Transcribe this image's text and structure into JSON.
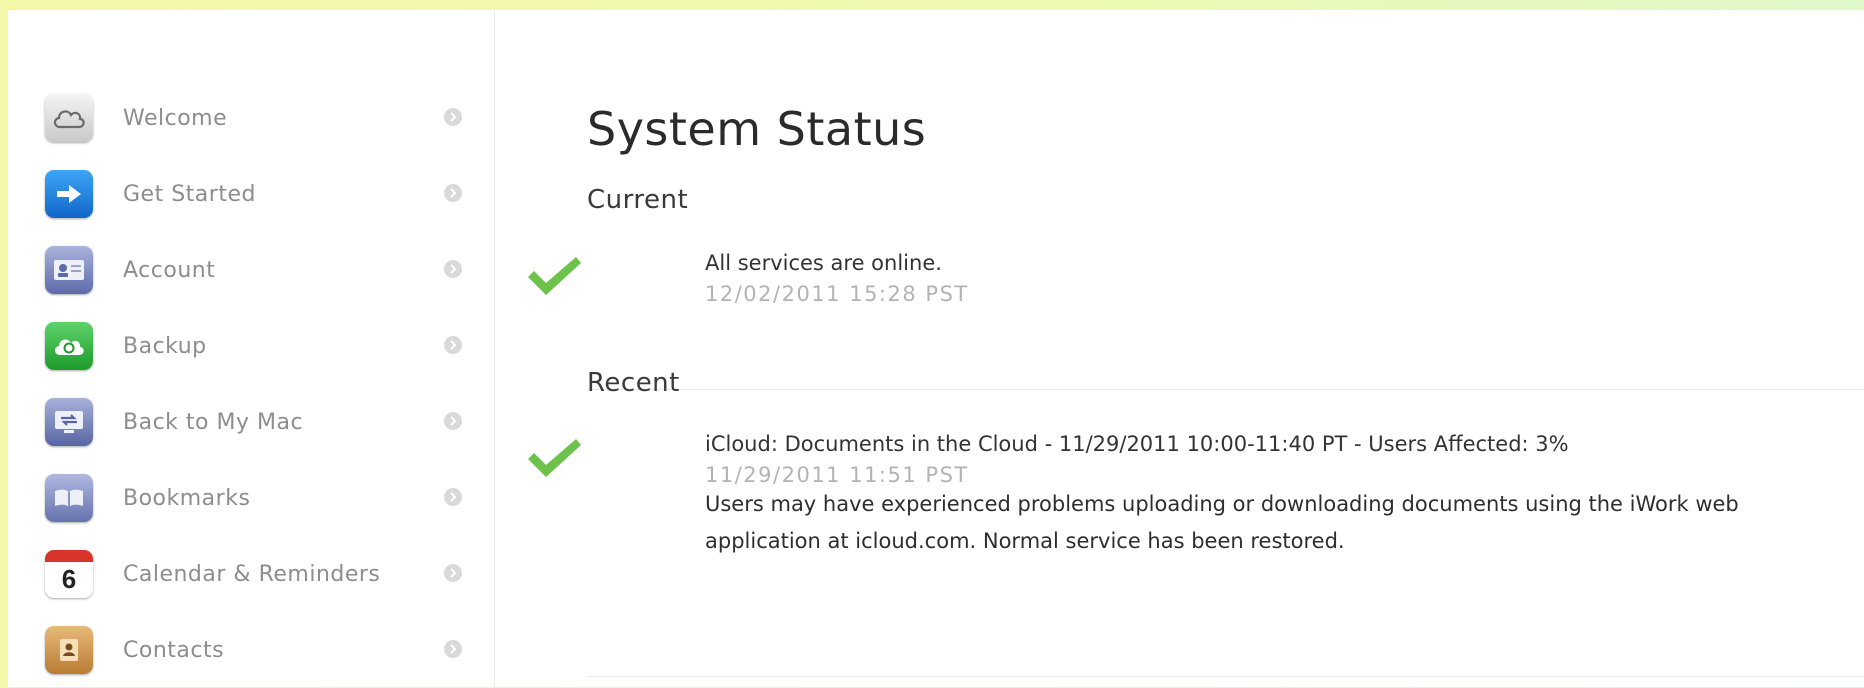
{
  "sidebar": {
    "items": [
      {
        "label": "Welcome",
        "icon": "icloud-icon"
      },
      {
        "label": "Get Started",
        "icon": "arrow-icon"
      },
      {
        "label": "Account",
        "icon": "account-card-icon"
      },
      {
        "label": "Backup",
        "icon": "backup-icon"
      },
      {
        "label": "Back to My Mac",
        "icon": "back-to-my-mac-icon"
      },
      {
        "label": "Bookmarks",
        "icon": "bookmarks-icon"
      },
      {
        "label": "Calendar & Reminders",
        "icon": "calendar-icon",
        "calendar_day": "6"
      },
      {
        "label": "Contacts",
        "icon": "contacts-icon"
      }
    ]
  },
  "main": {
    "title": "System Status",
    "current": {
      "heading": "Current",
      "status": {
        "title": "All services are online.",
        "time": "12/02/2011 15:28 PST",
        "icon": "checkmark-icon"
      }
    },
    "recent": {
      "heading": "Recent",
      "status": {
        "title": "iCloud: Documents in the Cloud - 11/29/2011 10:00-11:40 PT - Users Affected: 3%",
        "time": "11/29/2011 11:51 PST",
        "description": "Users may have experienced problems uploading or downloading documents using the iWork web application at icloud.com. Normal service has been restored.",
        "icon": "checkmark-icon"
      }
    }
  },
  "colors": {
    "check_green": "#6cc24a",
    "label_gray": "#8d8d8d",
    "time_gray": "#b3b3b3"
  }
}
